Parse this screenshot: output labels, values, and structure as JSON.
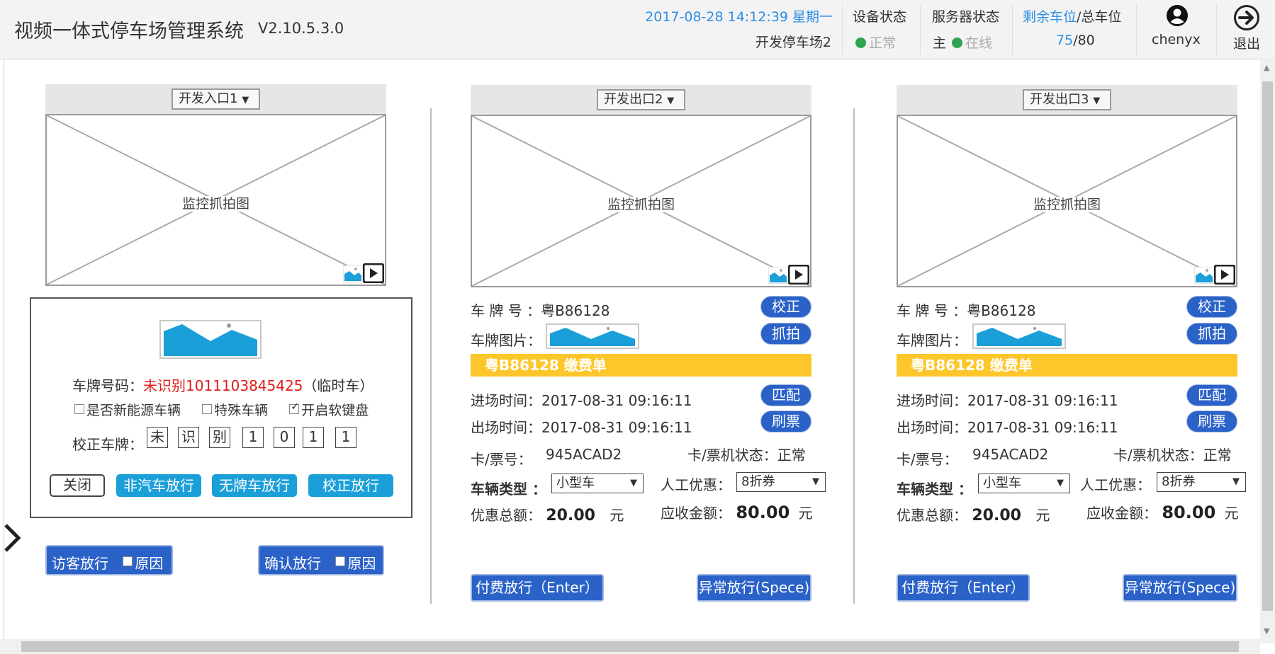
{
  "header": {
    "app_title": "视频一体式停车场管理系统",
    "version": "V2.10.5.3.0",
    "datetime": "2017-08-28 14:12:39 星期一",
    "lot_name": "开发停车场2",
    "device_status_label": "设备状态",
    "device_status_value": "正常",
    "server_status_label": "服务器状态",
    "server_role": "主",
    "server_status_value": "在线",
    "spaces_label_remaining": "剩余车位",
    "spaces_label_total": "/总车位",
    "spaces_remaining": "75",
    "spaces_total": "/80",
    "username": "chenyx",
    "logout_label": "退出"
  },
  "entry": {
    "camera_select": "开发入口1",
    "snapshot_label": "监控抓拍图",
    "plate_label": "车牌号码：",
    "plate_value": "未识别1011103845425",
    "plate_type": "（临时车）",
    "checkboxes": [
      {
        "label": "是否新能源车辆",
        "checked": false
      },
      {
        "label": "特殊车辆",
        "checked": false
      },
      {
        "label": "开启软键盘",
        "checked": true
      }
    ],
    "correct_label": "校正车牌：",
    "plate_chars": [
      "未",
      "识",
      "别",
      "1",
      "0",
      "1",
      "1"
    ],
    "buttons": {
      "close": "关闭",
      "non_vehicle": "非汽车放行",
      "no_plate": "无牌车放行",
      "corrected": "校正放行"
    },
    "visitor_release": "访客放行",
    "confirm_release": "确认放行",
    "reason_label": "原因"
  },
  "exits": [
    {
      "camera_select": "开发出口2",
      "snapshot_label": "监控抓拍图",
      "plate_label": "车 牌 号  ：",
      "plate_value": "粤B86128",
      "plate_image_label": "车牌图片：",
      "correct_button": "校正",
      "capture_button": "抓拍",
      "bill_title": "粤B86128  缴费单",
      "entry_time_label": "进场时间：",
      "entry_time": "2017-08-31 09:16:11",
      "exit_time_label": "出场时间：",
      "exit_time": "2017-08-31 09:16:11",
      "match_button": "匹配",
      "swipe_button": "刷票",
      "card_label": "卡/票号：",
      "card_no": "945ACAD2",
      "card_status": "卡/票机状态：正常",
      "vehicle_type_label": "车辆类型 ：",
      "vehicle_type": "小型车",
      "discount_label": "人工优惠：",
      "discount": "8折券",
      "discount_total_label": "优惠总额：",
      "discount_total": "20.00",
      "due_label": "应收金额：",
      "due": "80.00",
      "currency": "元",
      "pay_button": "付费放行（Enter）",
      "abnormal_button": "异常放行(Spece)"
    },
    {
      "camera_select": "开发出口3",
      "snapshot_label": "监控抓拍图",
      "plate_label": "车 牌 号  ：",
      "plate_value": "粤B86128",
      "plate_image_label": "车牌图片：",
      "correct_button": "校正",
      "capture_button": "抓拍",
      "bill_title": "粤B86128  缴费单",
      "entry_time_label": "进场时间：",
      "entry_time": "2017-08-31 09:16:11",
      "exit_time_label": "出场时间：",
      "exit_time": "2017-08-31 09:16:11",
      "match_button": "匹配",
      "swipe_button": "刷票",
      "card_label": "卡/票号：",
      "card_no": "945ACAD2",
      "card_status": "卡/票机状态：正常",
      "vehicle_type_label": "车辆类型 ：",
      "vehicle_type": "小型车",
      "discount_label": "人工优惠：",
      "discount": "8折券",
      "discount_total_label": "优惠总额：",
      "discount_total": "20.00",
      "due_label": "应收金额：",
      "due": "80.00",
      "currency": "元",
      "pay_button": "付费放行（Enter）",
      "abnormal_button": "异常放行(Spece)"
    }
  ],
  "colors": {
    "accent_blue": "#2e8fe6",
    "button_blue": "#1a9fd9",
    "button_dark_blue": "#2b62c8",
    "bill_yellow": "#fdc72c",
    "status_green": "#2ea44f",
    "plate_red": "#e21b1b"
  }
}
